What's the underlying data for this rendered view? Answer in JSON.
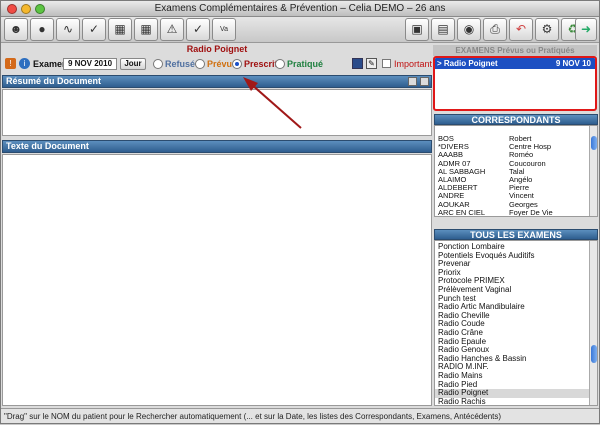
{
  "window": {
    "title": "Examens Complémentaires & Prévention – Celia DEMO – 26 ans"
  },
  "exam": {
    "title": "Radio Poignet",
    "label": "Examen",
    "date": "9 NOV 2010",
    "jour_button": "Jour",
    "refuse": "Refusé",
    "prevu": "Prévu",
    "prescrit": "Prescrit",
    "pratique": "Pratiqué",
    "important": "Important",
    "selected_status": "Prescrit"
  },
  "resume": {
    "header": "Résumé du Document"
  },
  "texte": {
    "header": "Texte du Document"
  },
  "prevus": {
    "header": "EXAMENS Prévus ou Pratiqués",
    "items": [
      {
        "name": "> Radio Poignet",
        "date": "9 NOV 10"
      }
    ]
  },
  "correspondants": {
    "header": "CORRESPONDANTS",
    "col1": [
      "BOS",
      "*DIVERS",
      "AAABB",
      "ADMR 07",
      "AL SABBAGH",
      "ALAIMO",
      "ALDEBERT",
      "ANDRE",
      "AOUKAR",
      "ARC EN CIEL"
    ],
    "col2": [
      "Robert",
      "Centre Hosp",
      "Roméo",
      "Coucouron",
      "Talal",
      "Angélo",
      "Pierre",
      "Vincent",
      "Georges",
      "Foyer De Vie"
    ]
  },
  "tous": {
    "header": "TOUS LES EXAMENS",
    "items": [
      "Ponction Lombaire",
      "Potentiels Evoqués Auditifs",
      "Prevenar",
      "Priorix",
      "Protocole PRIMEX",
      "Prélèvement Vaginal",
      "Punch test",
      "Radio Artic Mandibulaire",
      "Radio Cheville",
      "Radio Coude",
      "Radio Crâne",
      "Radio Epaule",
      "Radio Genoux",
      "Radio Hanches & Bassin",
      "RADIO M.INF.",
      "Radio Mains",
      "Radio Pied",
      "Radio Poignet",
      "Radio Rachis"
    ],
    "selected": "Radio Poignet"
  },
  "status": "\"Drag\" sur le NOM du patient pour le Rechercher automatiquement (... et sur la Date, les listes des Correspondants, Examens, Antécédents)",
  "toolbar_icons": [
    "person-search-icon",
    "pill-icon",
    "heart-monitor-icon",
    "notepad-check-icon",
    "certificate-icon",
    "calculator-icon",
    "warning-document-icon",
    "injection-icon",
    "pen-document-icon",
    "vaccine-icon",
    "cabinet-icon",
    "calendar-icon",
    "network-icon",
    "printer-icon",
    "undo-icon",
    "tools-icon",
    "recycle-icon",
    "exit-icon"
  ],
  "colors": {
    "accent_red": "#a01010",
    "header_blue": "#2f5e8f",
    "highlight": "#e01818",
    "selection": "#1c4fc2"
  }
}
